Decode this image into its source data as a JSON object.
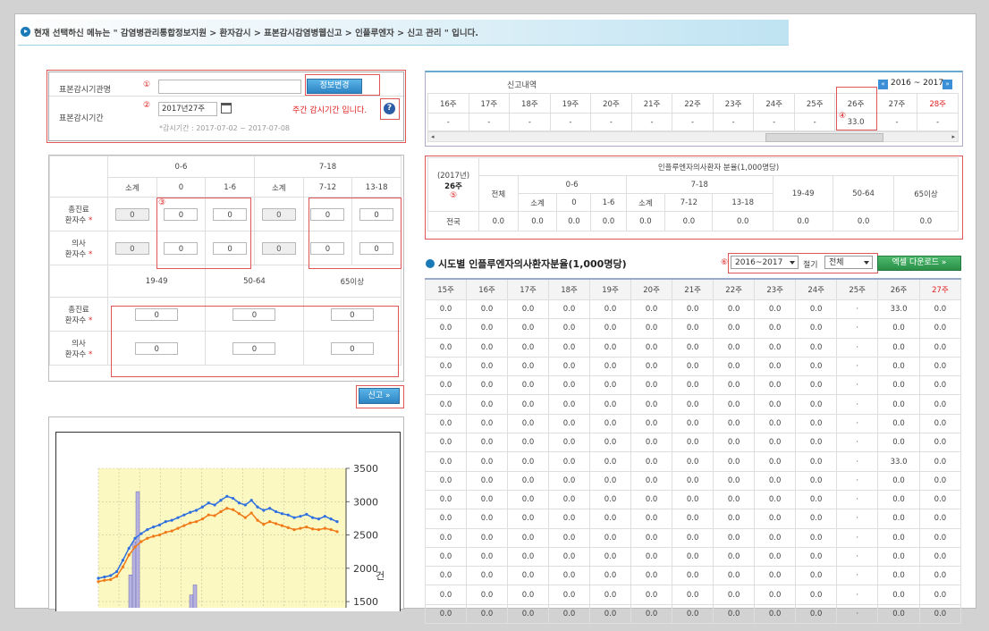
{
  "breadcrumb": "현재 선택하신 메뉴는 \" 감염병관리통합정보지원 > 환자감시 > 표본감시감염병웹신고 > 인플루엔자 > 신고 관리 \" 입니다.",
  "form": {
    "org_label": "표본감시기관명",
    "org_value": "",
    "change_btn": "정보변경",
    "period_label": "표본감시기간",
    "period_value": "2017년27주",
    "period_notice": "주간 감시기간 입니다.",
    "period_range": "*감시기간 : 2017-07-02 ~ 2017-07-08",
    "markers": [
      "①",
      "②",
      "③",
      "④",
      "⑤",
      "⑥"
    ]
  },
  "entry_table": {
    "group_0_6": "0-6",
    "group_7_18": "7-18",
    "sub_headers": [
      "소계",
      "0",
      "1-6",
      "소계",
      "7-12",
      "13-18"
    ],
    "row1_label_a": "총진료",
    "row1_label_b": "환자수",
    "row2_label_a": "의사",
    "row2_label_b": "환자수",
    "row1_values": [
      "0",
      "0",
      "0",
      "0",
      "0",
      "0"
    ],
    "row2_values": [
      "0",
      "0",
      "0",
      "0",
      "0",
      "0"
    ],
    "age_groups_2": [
      "19-49",
      "50-64",
      "65이상"
    ],
    "row3_values": [
      "0",
      "0",
      "0"
    ],
    "row4_values": [
      "0",
      "0",
      "0"
    ],
    "star": "*"
  },
  "report_btn": "신고 »",
  "history": {
    "title": "신고내역",
    "range": "2016 ~ 2017",
    "weeks": [
      "16주",
      "17주",
      "18주",
      "19주",
      "20주",
      "21주",
      "22주",
      "23주",
      "24주",
      "25주",
      "26주",
      "27주",
      "28주"
    ],
    "values": [
      "-",
      "-",
      "-",
      "-",
      "-",
      "-",
      "-",
      "-",
      "-",
      "-",
      "33.0",
      "-",
      "-"
    ]
  },
  "rate_table": {
    "year": "(2017년)",
    "week": "26주",
    "title": "인플루엔자의사환자 분율(1,000명당)",
    "total": "전체",
    "g_0_6": "0-6",
    "g_7_18": "7-18",
    "subs": [
      "소계",
      "0",
      "1-6",
      "소계",
      "7-12",
      "13-18"
    ],
    "g_19_49": "19-49",
    "g_50_64": "50-64",
    "g_65": "65이상",
    "row_label": "전국",
    "row_values": [
      "0.0",
      "0.0",
      "0.0",
      "0.0",
      "0.0",
      "0.0",
      "0.0",
      "0.0",
      "0.0",
      "0.0"
    ]
  },
  "regional": {
    "title": "시도별 인플루엔자의사환자분율(1,000명당)",
    "season_select": "2016~2017",
    "season_label": "절기",
    "region_select": "전체",
    "excel_btn": "엑셀 다운로드 »",
    "weeks": [
      "15주",
      "16주",
      "17주",
      "18주",
      "19주",
      "20주",
      "21주",
      "22주",
      "23주",
      "24주",
      "25주",
      "26주",
      "27주"
    ],
    "rows": [
      [
        "0.0",
        "0.0",
        "0.0",
        "0.0",
        "0.0",
        "0.0",
        "0.0",
        "0.0",
        "0.0",
        "0.0",
        "·",
        "33.0",
        "0.0"
      ],
      [
        "0.0",
        "0.0",
        "0.0",
        "0.0",
        "0.0",
        "0.0",
        "0.0",
        "0.0",
        "0.0",
        "0.0",
        "·",
        "0.0",
        "0.0"
      ],
      [
        "0.0",
        "0.0",
        "0.0",
        "0.0",
        "0.0",
        "0.0",
        "0.0",
        "0.0",
        "0.0",
        "0.0",
        "·",
        "0.0",
        "0.0"
      ],
      [
        "0.0",
        "0.0",
        "0.0",
        "0.0",
        "0.0",
        "0.0",
        "0.0",
        "0.0",
        "0.0",
        "0.0",
        "·",
        "0.0",
        "0.0"
      ],
      [
        "0.0",
        "0.0",
        "0.0",
        "0.0",
        "0.0",
        "0.0",
        "0.0",
        "0.0",
        "0.0",
        "0.0",
        "·",
        "0.0",
        "0.0"
      ],
      [
        "0.0",
        "0.0",
        "0.0",
        "0.0",
        "0.0",
        "0.0",
        "0.0",
        "0.0",
        "0.0",
        "0.0",
        "·",
        "0.0",
        "0.0"
      ],
      [
        "0.0",
        "0.0",
        "0.0",
        "0.0",
        "0.0",
        "0.0",
        "0.0",
        "0.0",
        "0.0",
        "0.0",
        "·",
        "0.0",
        "0.0"
      ],
      [
        "0.0",
        "0.0",
        "0.0",
        "0.0",
        "0.0",
        "0.0",
        "0.0",
        "0.0",
        "0.0",
        "0.0",
        "·",
        "0.0",
        "0.0"
      ],
      [
        "0.0",
        "0.0",
        "0.0",
        "0.0",
        "0.0",
        "0.0",
        "0.0",
        "0.0",
        "0.0",
        "0.0",
        "·",
        "33.0",
        "0.0"
      ],
      [
        "0.0",
        "0.0",
        "0.0",
        "0.0",
        "0.0",
        "0.0",
        "0.0",
        "0.0",
        "0.0",
        "0.0",
        "·",
        "0.0",
        "0.0"
      ],
      [
        "0.0",
        "0.0",
        "0.0",
        "0.0",
        "0.0",
        "0.0",
        "0.0",
        "0.0",
        "0.0",
        "0.0",
        "·",
        "0.0",
        "0.0"
      ],
      [
        "0.0",
        "0.0",
        "0.0",
        "0.0",
        "0.0",
        "0.0",
        "0.0",
        "0.0",
        "0.0",
        "0.0",
        "·",
        "0.0",
        "0.0"
      ],
      [
        "0.0",
        "0.0",
        "0.0",
        "0.0",
        "0.0",
        "0.0",
        "0.0",
        "0.0",
        "0.0",
        "0.0",
        "·",
        "0.0",
        "0.0"
      ],
      [
        "0.0",
        "0.0",
        "0.0",
        "0.0",
        "0.0",
        "0.0",
        "0.0",
        "0.0",
        "0.0",
        "0.0",
        "·",
        "0.0",
        "0.0"
      ],
      [
        "0.0",
        "0.0",
        "0.0",
        "0.0",
        "0.0",
        "0.0",
        "0.0",
        "0.0",
        "0.0",
        "0.0",
        "·",
        "0.0",
        "0.0"
      ],
      [
        "0.0",
        "0.0",
        "0.0",
        "0.0",
        "0.0",
        "0.0",
        "0.0",
        "0.0",
        "0.0",
        "0.0",
        "·",
        "0.0",
        "0.0"
      ],
      [
        "0.0",
        "0.0",
        "0.0",
        "0.0",
        "0.0",
        "0.0",
        "0.0",
        "0.0",
        "0.0",
        "0.0",
        "·",
        "0.0",
        "0.0"
      ]
    ]
  },
  "chart_data": {
    "type": "line",
    "yticks": [
      "3500",
      "3000",
      "2500",
      "2000",
      "1500"
    ],
    "ylabel": "건",
    "ylim": [
      1300,
      3500
    ],
    "grid": true,
    "series": [
      {
        "color": "#2f6fe0",
        "values": [
          1850,
          1870,
          1890,
          1950,
          2120,
          2300,
          2450,
          2520,
          2580,
          2620,
          2650,
          2700,
          2720,
          2760,
          2800,
          2840,
          2870,
          2920,
          2980,
          2950,
          3020,
          3080,
          3050,
          2980,
          2950,
          3020,
          2920,
          2870,
          2900,
          2850,
          2820,
          2800,
          2760,
          2780,
          2810,
          2760,
          2740,
          2780,
          2740,
          2700
        ]
      },
      {
        "color": "#f07a18",
        "values": [
          1800,
          1820,
          1830,
          1880,
          2020,
          2200,
          2320,
          2400,
          2450,
          2480,
          2500,
          2540,
          2560,
          2600,
          2640,
          2680,
          2700,
          2740,
          2800,
          2790,
          2850,
          2900,
          2880,
          2820,
          2760,
          2830,
          2720,
          2660,
          2700,
          2670,
          2640,
          2610,
          2580,
          2600,
          2620,
          2590,
          2580,
          2600,
          2580,
          2550
        ]
      }
    ],
    "bars": [
      1900,
      2400,
      3150,
      1600,
      1750
    ]
  }
}
